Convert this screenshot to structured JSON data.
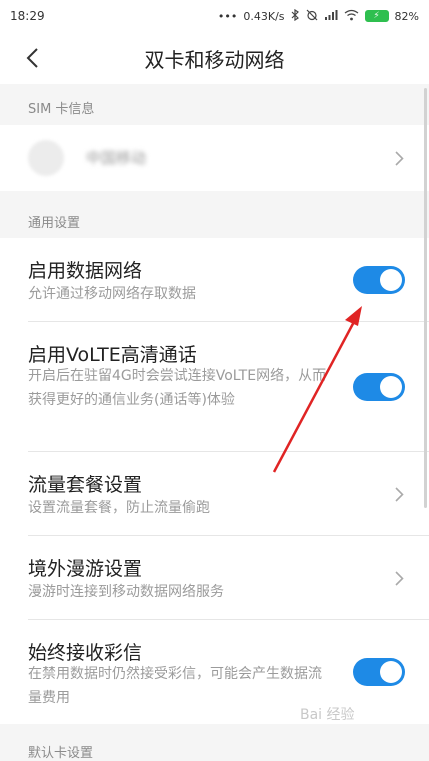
{
  "status_bar": {
    "time": "18:29",
    "dots": "•••",
    "net_speed": "0.43K/s",
    "battery_pct": "82%"
  },
  "header": {
    "title": "双卡和移动网络"
  },
  "sim_section": {
    "label": "SIM 卡信息",
    "carrier": "中国移动"
  },
  "general_section": {
    "label": "通用设置"
  },
  "settings": [
    {
      "title": "启用数据网络",
      "subtitle": "允许通过移动网络存取数据",
      "control": "toggle",
      "on": true
    },
    {
      "title": "启用VoLTE高清通话",
      "subtitle": "开启后在驻留4G时会尝试连接VoLTE网络，从而获得更好的通信业务(通话等)体验",
      "control": "toggle",
      "on": true
    },
    {
      "title": "流量套餐设置",
      "subtitle": "设置流量套餐，防止流量偷跑",
      "control": "chevron"
    },
    {
      "title": "境外漫游设置",
      "subtitle": "漫游时连接到移动数据网络服务",
      "control": "chevron"
    },
    {
      "title": "始终接收彩信",
      "subtitle": "在禁用数据时仍然接受彩信，可能会产生数据流量费用",
      "control": "toggle",
      "on": true
    }
  ],
  "default_section": {
    "label": "默认卡设置"
  },
  "watermark": "Bai 经验",
  "colors": {
    "accent": "#1e8ae6",
    "annotation": "#e02424"
  }
}
